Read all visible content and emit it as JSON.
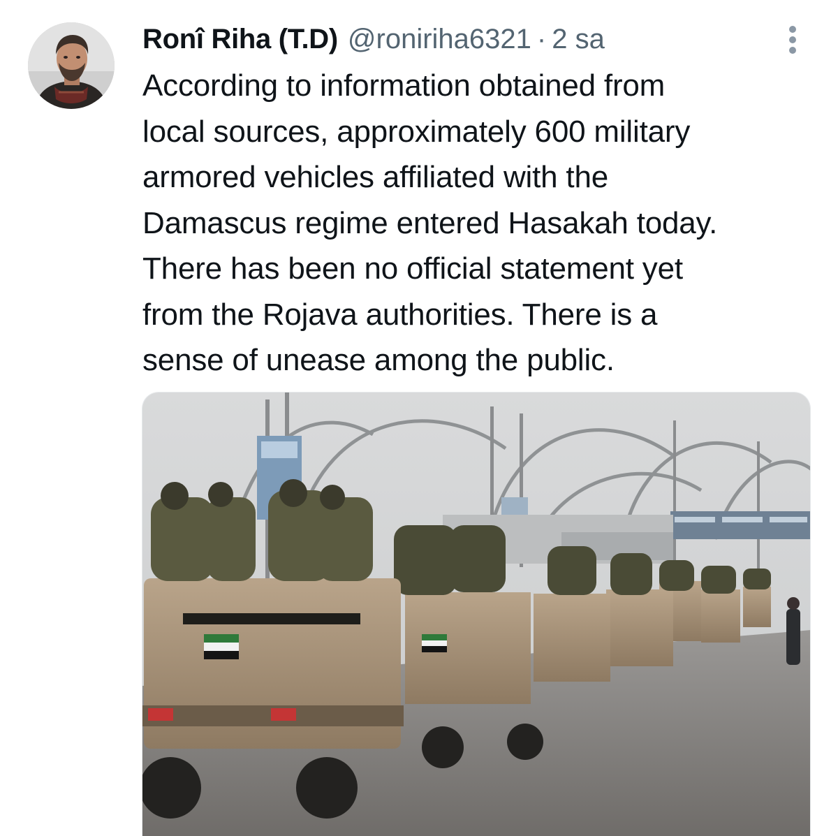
{
  "tweet": {
    "display_name": "Ronî Riha (T.D)",
    "handle": "@roniriha6321",
    "separator": "·",
    "time": "2 sa",
    "text_lines": [
      "According to information obtained from",
      "local sources, approximately 600 military",
      "armored vehicles affiliated with the",
      "Damascus regime entered Hasakah today.",
      "There has been no official statement yet",
      "from the Rojava authorities. There is a",
      "sense of unease among the public."
    ]
  },
  "icons": {
    "more": "more-vertical-icon",
    "avatar": "user-avatar"
  },
  "colors": {
    "text_primary": "#0f1419",
    "text_secondary": "#536471",
    "icon_gray": "#8b98a5",
    "background": "#ffffff"
  }
}
